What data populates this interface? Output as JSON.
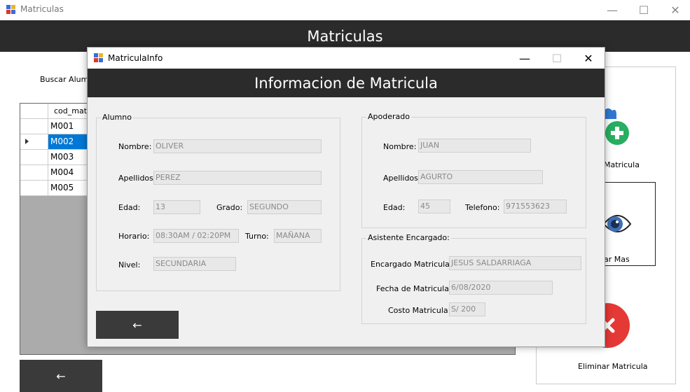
{
  "main_window": {
    "title": "Matriculas",
    "header": "Matriculas",
    "search_label": "Buscar Alum",
    "minimize_glyph": "—",
    "maximize_glyph": "☐",
    "close_glyph": "✕",
    "back_glyph": "←"
  },
  "grid": {
    "column_header": "cod_matric",
    "rows": [
      "M001",
      "M002",
      "M003",
      "M004",
      "M005"
    ],
    "selected_row_index": 1
  },
  "side_actions": {
    "add_label": "Matricula",
    "view_label": "ar Mas",
    "delete_label": "Eliminar Matricula"
  },
  "dialog": {
    "title": "MatriculaInfo",
    "header": "Informacion de Matricula",
    "minimize_glyph": "—",
    "maximize_glyph": "☐",
    "close_glyph": "✕",
    "back_glyph": "←",
    "alumno": {
      "legend": "Alumno",
      "nombre_label": "Nombre:",
      "nombre": "OLIVER",
      "apellidos_label": "Apellidos:",
      "apellidos": "PEREZ",
      "edad_label": "Edad:",
      "edad": "13",
      "grado_label": "Grado:",
      "grado": "SEGUNDO",
      "horario_label": "Horario:",
      "horario": "08:30AM / 02:20PM",
      "turno_label": "Turno:",
      "turno": "MAÑANA",
      "nivel_label": "Nivel:",
      "nivel": "SECUNDARIA"
    },
    "apoderado": {
      "legend": "Apoderado",
      "nombre_label": "Nombre:",
      "nombre": "JUAN",
      "apellidos_label": "Apellidos:",
      "apellidos": "AGURTO",
      "edad_label": "Edad:",
      "edad": "45",
      "telefono_label": "Telefono:",
      "telefono": "971553623"
    },
    "asistente": {
      "legend": "Asistente Encargado:",
      "encargado_label": "Encargado Matricula:",
      "encargado": "JESUS SALDARRIAGA",
      "fecha_label": "Fecha de Matricula:",
      "fecha": "6/08/2020",
      "costo_label": "Costo Matricula:",
      "costo": "S/ 200"
    }
  },
  "colors": {
    "header_bg": "#2b2b2b",
    "selection": "#0078d7",
    "add_green": "#27ae60",
    "delete_red": "#e53935"
  }
}
